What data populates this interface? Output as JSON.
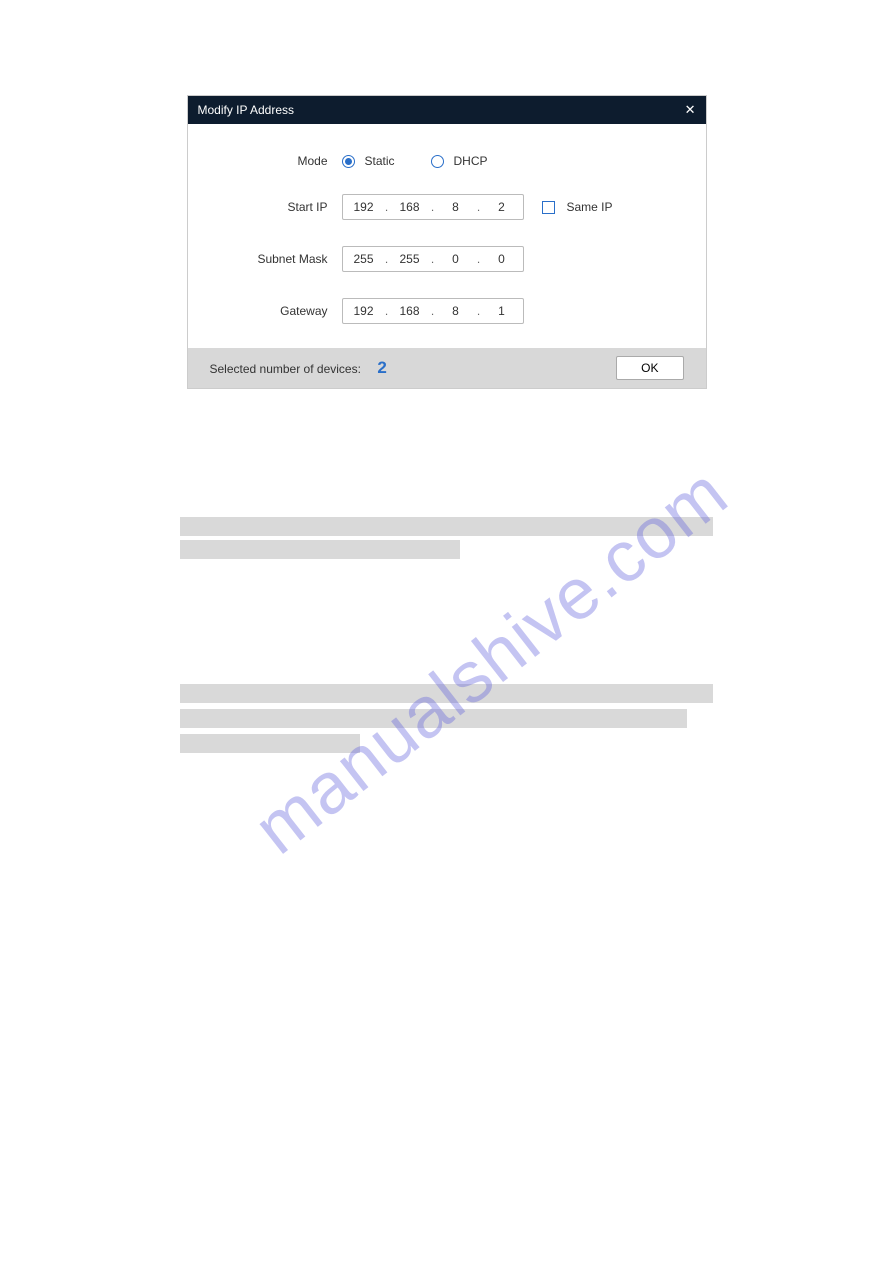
{
  "dialog": {
    "title": "Modify IP Address",
    "mode_label": "Mode",
    "mode_static": "Static",
    "mode_dhcp": "DHCP",
    "start_ip_label": "Start IP",
    "start_ip": {
      "o1": "192",
      "o2": "168",
      "o3": "8",
      "o4": "2"
    },
    "same_ip_label": "Same IP",
    "subnet_label": "Subnet Mask",
    "subnet": {
      "o1": "255",
      "o2": "255",
      "o3": "0",
      "o4": "0"
    },
    "gateway_label": "Gateway",
    "gateway": {
      "o1": "192",
      "o2": "168",
      "o3": "8",
      "o4": "1"
    },
    "footer_text": "Selected number of devices:",
    "device_count": "2",
    "ok_label": "OK"
  },
  "watermark": "manualshive.com"
}
